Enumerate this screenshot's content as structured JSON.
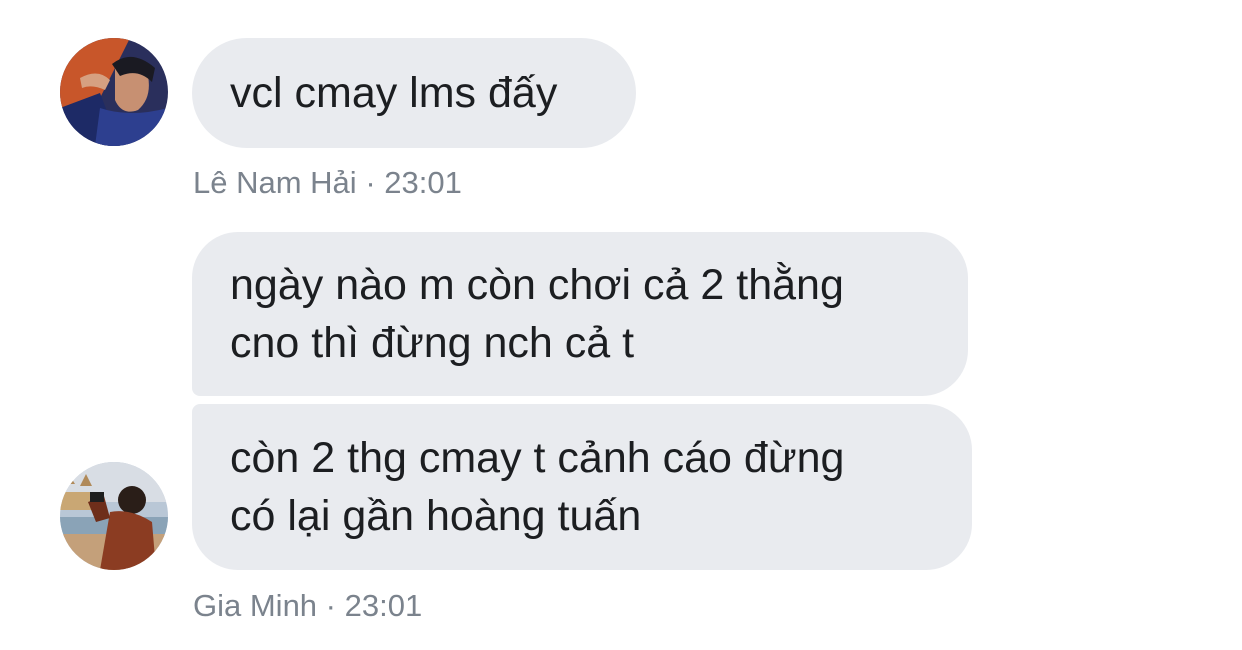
{
  "messages": [
    {
      "group": "hai",
      "lines": [
        "vcl cmay lms đấy"
      ]
    },
    {
      "group": "minh",
      "lines": [
        "ngày nào m còn chơi cả 2 thằng",
        "cno thì đừng nch cả t"
      ]
    },
    {
      "group": "minh",
      "lines": [
        "còn 2 thg cmay t cảnh cáo đừng",
        "có lại gần hoàng tuấn"
      ]
    }
  ],
  "senders": {
    "hai": {
      "name": "Lê Nam Hải",
      "separator": "·",
      "time": "23:01",
      "avatar_icon": "user-avatar-photo"
    },
    "minh": {
      "name": "Gia Minh",
      "separator": "·",
      "time": "23:01",
      "avatar_icon": "user-avatar-photo"
    }
  },
  "colors": {
    "bubble_bg": "#e9ebef",
    "bubble_text": "#1c1e21",
    "meta_text": "#7b838d"
  }
}
